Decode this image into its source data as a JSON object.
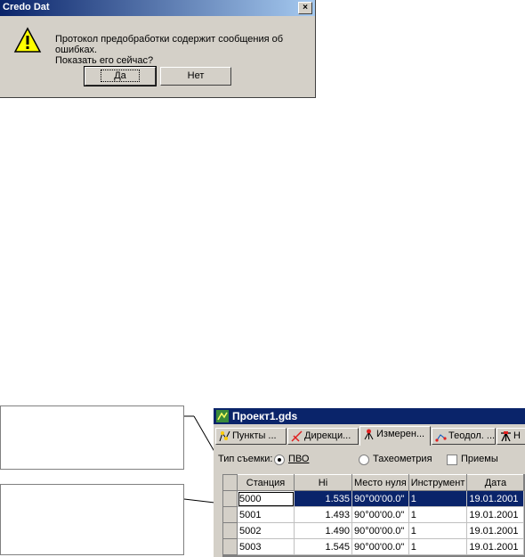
{
  "dialog": {
    "title": "Credo Dat",
    "close_glyph": "×",
    "message_line1": "Протокол предобработки содержит сообщения об ошибках.",
    "message_line2": "Показать его сейчас?",
    "yes_label": "Да",
    "no_label": "Нет"
  },
  "app": {
    "title": "Проект1.gds",
    "tabs": [
      {
        "label": "Пункты ..."
      },
      {
        "label": "Дирекци..."
      },
      {
        "label": "Измерен..."
      },
      {
        "label": "Теодол. ..."
      },
      {
        "label": "Н"
      }
    ],
    "survey": {
      "type_label": "Тип съемки:",
      "option1": "ПВО",
      "option2": "Тахеометрия",
      "checkbox_label": "Приемы"
    },
    "table": {
      "columns": [
        "Станция",
        "Hi",
        "Место нуля",
        "Инструмент",
        "Дата"
      ],
      "rows": [
        [
          "5000",
          "1.535",
          "90°00'00.0\"",
          "1",
          "19.01.2001"
        ],
        [
          "5001",
          "1.493",
          "90°00'00.0\"",
          "1",
          "19.01.2001"
        ],
        [
          "5002",
          "1.490",
          "90°00'00.0\"",
          "1",
          "19.01.2001"
        ],
        [
          "5003",
          "1.545",
          "90°00'00.0\"",
          "1",
          "19.01.2001"
        ]
      ]
    }
  },
  "colors": {
    "titlebar": "#0a246a",
    "selection": "#0a246a",
    "face": "#d4d0c8"
  }
}
